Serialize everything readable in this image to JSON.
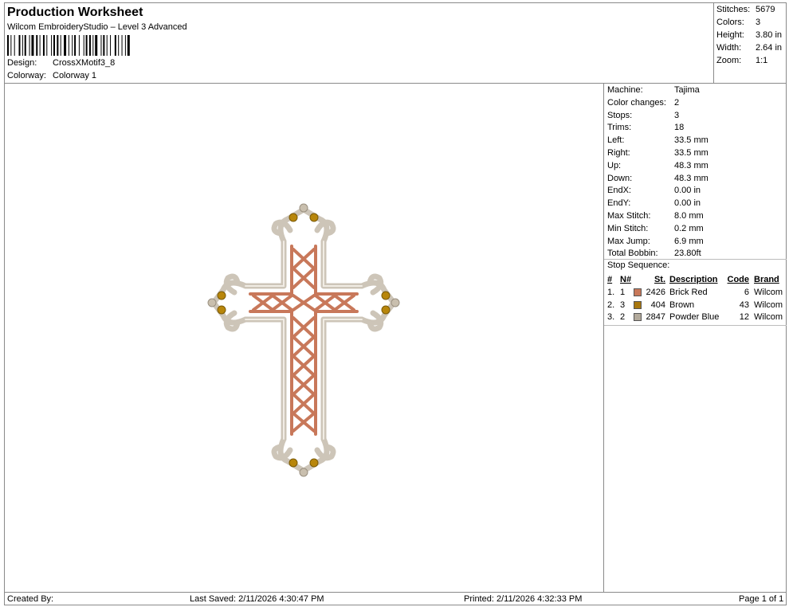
{
  "header": {
    "title": "Production Worksheet",
    "subtitle": "Wilcom EmbroideryStudio – Level 3 Advanced",
    "design_label": "Design:",
    "design_value": "CrossXMotif3_8",
    "colorway_label": "Colorway:",
    "colorway_value": "Colorway 1"
  },
  "stats": [
    {
      "label": "Stitches:",
      "value": "5679"
    },
    {
      "label": "Colors:",
      "value": "3"
    },
    {
      "label": "Height:",
      "value": "3.80 in"
    },
    {
      "label": "Width:",
      "value": "2.64 in"
    },
    {
      "label": "Zoom:",
      "value": "1:1"
    }
  ],
  "machine_info": [
    {
      "label": "Machine:",
      "value": "Tajima"
    },
    {
      "label": "Color changes:",
      "value": "2"
    },
    {
      "label": "Stops:",
      "value": "3"
    },
    {
      "label": "Trims:",
      "value": "18"
    },
    {
      "label": "Left:",
      "value": "33.5 mm"
    },
    {
      "label": "Right:",
      "value": "33.5 mm"
    },
    {
      "label": "Up:",
      "value": "48.3 mm"
    },
    {
      "label": "Down:",
      "value": "48.3 mm"
    },
    {
      "label": "EndX:",
      "value": "0.00 in"
    },
    {
      "label": "EndY:",
      "value": "0.00 in"
    },
    {
      "label": "Max Stitch:",
      "value": "8.0 mm"
    },
    {
      "label": "Min Stitch:",
      "value": "0.2 mm"
    },
    {
      "label": "Max Jump:",
      "value": "6.9 mm"
    },
    {
      "label": "Total Bobbin:",
      "value": "23.80ft"
    }
  ],
  "stop_sequence": {
    "title": "Stop Sequence:",
    "columns": [
      "#",
      "N#",
      "St.",
      "Description",
      "Code",
      "Brand"
    ],
    "rows": [
      {
        "num": "1.",
        "n": "1",
        "color": "#c8785a",
        "st": "2426",
        "description": "Brick Red",
        "code": "6",
        "brand": "Wilcom"
      },
      {
        "num": "2.",
        "n": "3",
        "color": "#a8770f",
        "st": "404",
        "description": "Brown",
        "code": "43",
        "brand": "Wilcom"
      },
      {
        "num": "3.",
        "n": "2",
        "color": "#b3aa9c",
        "st": "2847",
        "description": "Powder Blue",
        "code": "12",
        "brand": "Wilcom"
      }
    ]
  },
  "footer": {
    "created_by": "Created By:",
    "last_saved": "Last Saved: 2/11/2026 4:30:47 PM",
    "printed": "Printed: 2/11/2026 4:32:33 PM",
    "page": "Page 1 of 1"
  },
  "colors": {
    "brick_red": "#c8785a",
    "brown": "#a8770f",
    "powder_blue": "#b3aa9c",
    "border": "#8a8a8a"
  }
}
